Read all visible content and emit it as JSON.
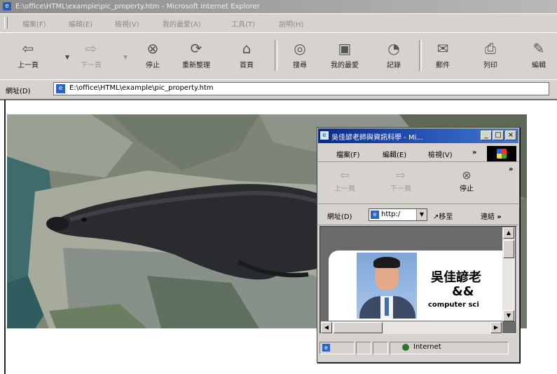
{
  "window": {
    "title": "E:\\office\\HTML\\example\\pic_property.htm - Microsoft Internet Explorer"
  },
  "menu": [
    "檔案(F)",
    "編輯(E)",
    "檢視(V)",
    "我的最愛(A)",
    "工具(T)",
    "說明(H)"
  ],
  "toolbar": {
    "back": "上一頁",
    "forward": "下一頁",
    "stop": "停止",
    "refresh": "重新整理",
    "home": "首頁",
    "search": "搜尋",
    "favorites": "我的最愛",
    "history": "記錄",
    "mail": "郵件",
    "print": "列印",
    "edit": "編輯"
  },
  "address": {
    "label": "網址(D)",
    "url": "E:\\office\\HTML\\example\\pic_property.htm"
  },
  "popup": {
    "title": "吳佳諺老師與資訊科學 - Mi...",
    "menu": [
      "檔案(F)",
      "編輯(E)",
      "檢視(V)"
    ],
    "more": "»",
    "toolbar": {
      "back": "上一頁",
      "forward": "下一頁",
      "stop": "停止"
    },
    "address_label": "網址(D)",
    "address_value": "http:/",
    "go": "移至",
    "links": "連結",
    "content": {
      "name": "吳佳諺老",
      "amp": "&&",
      "subtitle": "computer sci"
    },
    "status_zone": "Internet"
  },
  "icons": {
    "back": "back-arrow-icon",
    "forward": "forward-arrow-icon",
    "stop": "stop-icon",
    "refresh": "refresh-icon",
    "home": "home-icon",
    "search": "search-icon",
    "favorites": "favorites-icon",
    "history": "history-icon",
    "mail": "mail-icon",
    "print": "print-icon",
    "edit": "edit-icon"
  },
  "colors": {
    "chrome": "#d6d3ce",
    "popup_title": "#0a2a8a",
    "main_title_inactive": "#8d8d8d"
  }
}
